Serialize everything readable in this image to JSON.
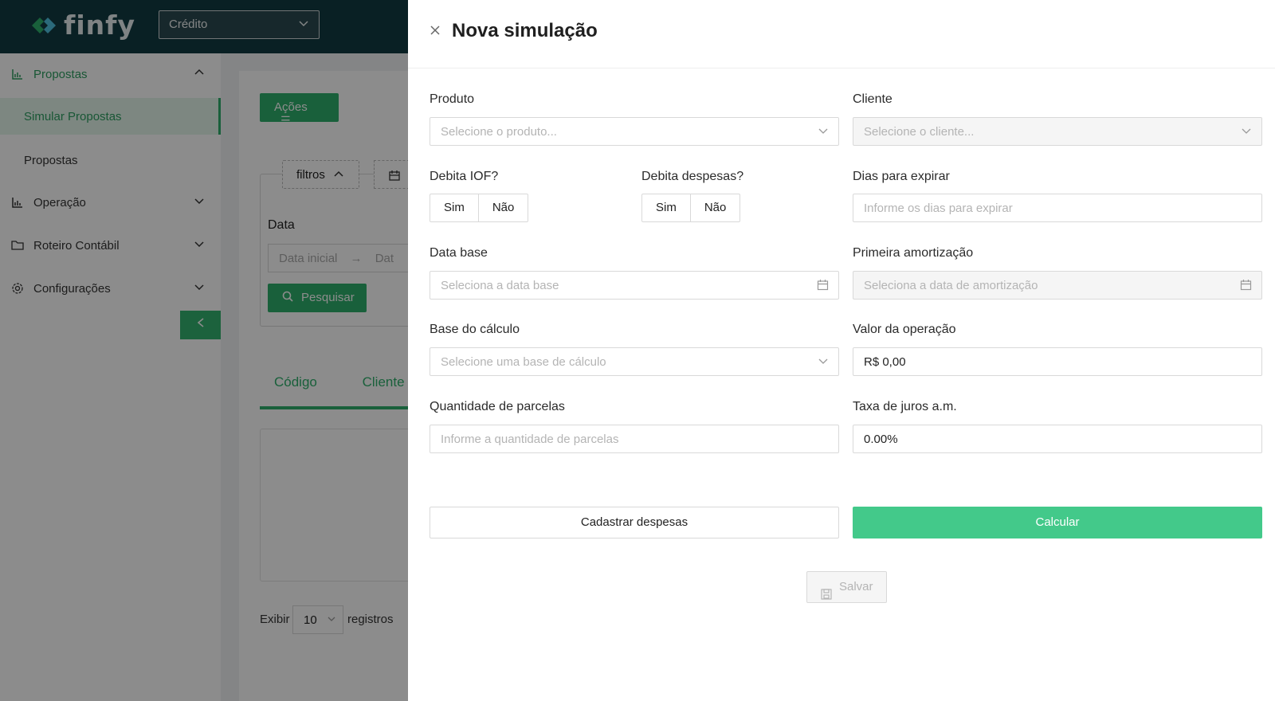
{
  "app": {
    "logo_text": "finfy",
    "module_select": "Crédito"
  },
  "sidebar": {
    "items": [
      {
        "label": "Propostas",
        "icon": "bar-chart-icon"
      },
      {
        "label": "Operação",
        "icon": "bar-chart-icon"
      },
      {
        "label": "Roteiro Contábil",
        "icon": "folder-icon"
      },
      {
        "label": "Configurações",
        "icon": "gear-icon"
      }
    ],
    "subitems": [
      {
        "label": "Simular Propostas",
        "active": true
      },
      {
        "label": "Propostas",
        "active": false
      }
    ],
    "collapse_icon": "chevron-left-icon"
  },
  "content": {
    "acoes_label": "Ações",
    "filtros_label": "filtros",
    "data_label": "Data",
    "date_start_placeholder": "Data inicial",
    "date_end_placeholder": "Dat",
    "pesquisar_label": "Pesquisar",
    "table_headers": [
      "Código",
      "Cliente"
    ],
    "exibir_label": "Exibir",
    "page_size": "10",
    "registros_label": "registros"
  },
  "drawer": {
    "title": "Nova simulação",
    "produto": {
      "label": "Produto",
      "placeholder": "Selecione o produto..."
    },
    "cliente": {
      "label": "Cliente",
      "placeholder": "Selecione o cliente..."
    },
    "debita_iof": {
      "label": "Debita IOF?",
      "options": [
        "Sim",
        "Não"
      ]
    },
    "debita_despesas": {
      "label": "Debita despesas?",
      "options": [
        "Sim",
        "Não"
      ]
    },
    "dias_expirar": {
      "label": "Dias para expirar",
      "placeholder": "Informe os dias para expirar"
    },
    "data_base": {
      "label": "Data base",
      "placeholder": "Seleciona a data base"
    },
    "primeira_amortizacao": {
      "label": "Primeira amortização",
      "placeholder": "Seleciona a data de amortização"
    },
    "base_calculo": {
      "label": "Base do cálculo",
      "placeholder": "Selecione uma base de cálculo"
    },
    "valor_operacao": {
      "label": "Valor da operação",
      "value": "R$ 0,00"
    },
    "quantidade_parcelas": {
      "label": "Quantidade de parcelas",
      "placeholder": "Informe a quantidade de parcelas"
    },
    "taxa_juros": {
      "label": "Taxa de juros a.m.",
      "value": "0.00%"
    },
    "cadastrar_despesas_label": "Cadastrar despesas",
    "calcular_label": "Calcular",
    "salvar_label": "Salvar"
  },
  "colors": {
    "primary_green": "#2fb06c",
    "calc_green": "#43c98a",
    "topbar": "#123b43"
  }
}
